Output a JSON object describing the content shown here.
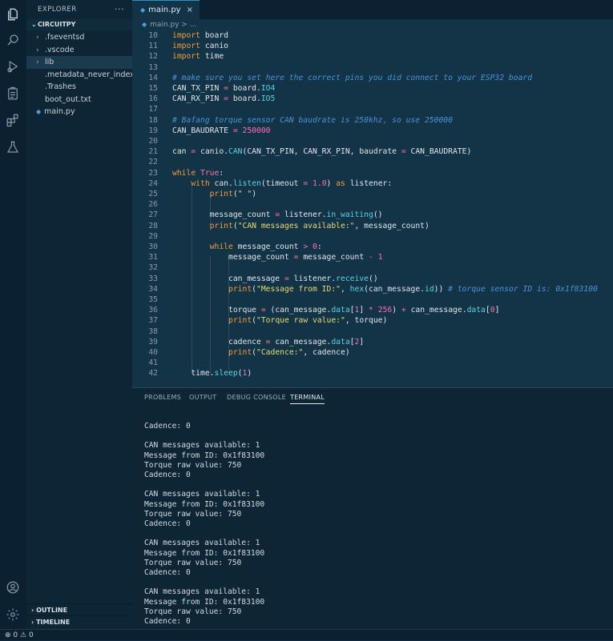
{
  "sidebar": {
    "title": "EXPLORER",
    "more": "···",
    "section": "CIRCUITPY",
    "items": [
      {
        "label": ".fseventsd",
        "kind": "folder"
      },
      {
        "label": ".vscode",
        "kind": "folder"
      },
      {
        "label": "lib",
        "kind": "folder"
      },
      {
        "label": ".metadata_never_index",
        "kind": "file"
      },
      {
        "label": ".Trashes",
        "kind": "file"
      },
      {
        "label": "boot_out.txt",
        "kind": "file"
      },
      {
        "label": "main.py",
        "kind": "python"
      }
    ],
    "outline": "OUTLINE",
    "timeline": "TIMELINE"
  },
  "tab": {
    "label": "main.py",
    "close": "×"
  },
  "breadcrumb": {
    "file": "main.py",
    "sep": "> ..."
  },
  "code": {
    "line_numbers": [
      "10",
      "11",
      "12",
      "13",
      "14",
      "15",
      "16",
      "17",
      "18",
      "19",
      "20",
      "21",
      "22",
      "23",
      "24",
      "25",
      "26",
      "27",
      "28",
      "29",
      "30",
      "31",
      "32",
      "33",
      "34",
      "35",
      "36",
      "37",
      "38",
      "39",
      "40",
      "41",
      "42"
    ]
  },
  "panel": {
    "tabs": [
      "PROBLEMS",
      "OUTPUT",
      "DEBUG CONSOLE",
      "TERMINAL"
    ],
    "terminal_lines": [
      "Cadence: 0",
      "",
      "CAN messages available: 1",
      "Message from ID: 0x1f83100",
      "Torque raw value: 750",
      "Cadence: 0",
      "",
      "CAN messages available: 1",
      "Message from ID: 0x1f83100",
      "Torque raw value: 750",
      "Cadence: 0",
      "",
      "CAN messages available: 1",
      "Message from ID: 0x1f83100",
      "Torque raw value: 750",
      "Cadence: 0",
      "",
      "CAN messages available: 1",
      "Message from ID: 0x1f83100",
      "Torque raw value: 750",
      "Cadence: 0"
    ]
  },
  "status": {
    "errors": "0",
    "warnings": "0"
  },
  "colors": {
    "accent": "#2e90c9",
    "editor_bg": "#133347",
    "keyword": "#f29d3c",
    "string": "#e6db74",
    "comment": "#4b93d9",
    "function": "#5fd2e3",
    "number": "#ff6fae"
  }
}
